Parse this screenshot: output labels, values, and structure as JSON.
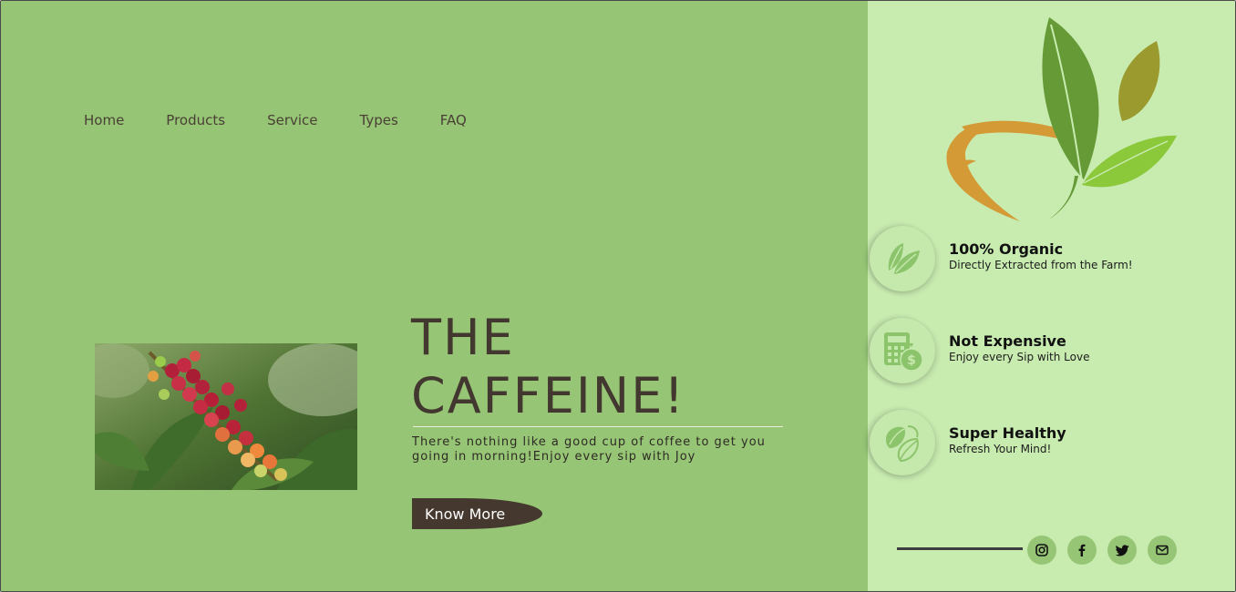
{
  "nav": {
    "items": [
      "Home",
      "Products",
      "Service",
      "Types",
      "FAQ"
    ]
  },
  "hero": {
    "title_line1": "THE",
    "title_line2": "CAFFEINE!",
    "text": "There's nothing like a good cup of coffee to get you going in morning!Enjoy every sip with Joy",
    "button": "Know More"
  },
  "features": [
    {
      "title": "100% Organic",
      "subtitle": "Directly Extracted from the Farm!",
      "icon": "leaf-icon"
    },
    {
      "title": "Not Expensive",
      "subtitle": "Enjoy every Sip with Love",
      "icon": "calculator-money-icon"
    },
    {
      "title": "Super Healthy",
      "subtitle": "Refresh Your Mind!",
      "icon": "coffee-beans-icon"
    }
  ],
  "social": [
    "instagram-icon",
    "facebook-icon",
    "twitter-icon",
    "mail-icon"
  ],
  "colors": {
    "main_bg": "#96c675",
    "side_bg": "#c8ebb0",
    "text_dark": "#43382f",
    "button_bg": "#45392f"
  }
}
